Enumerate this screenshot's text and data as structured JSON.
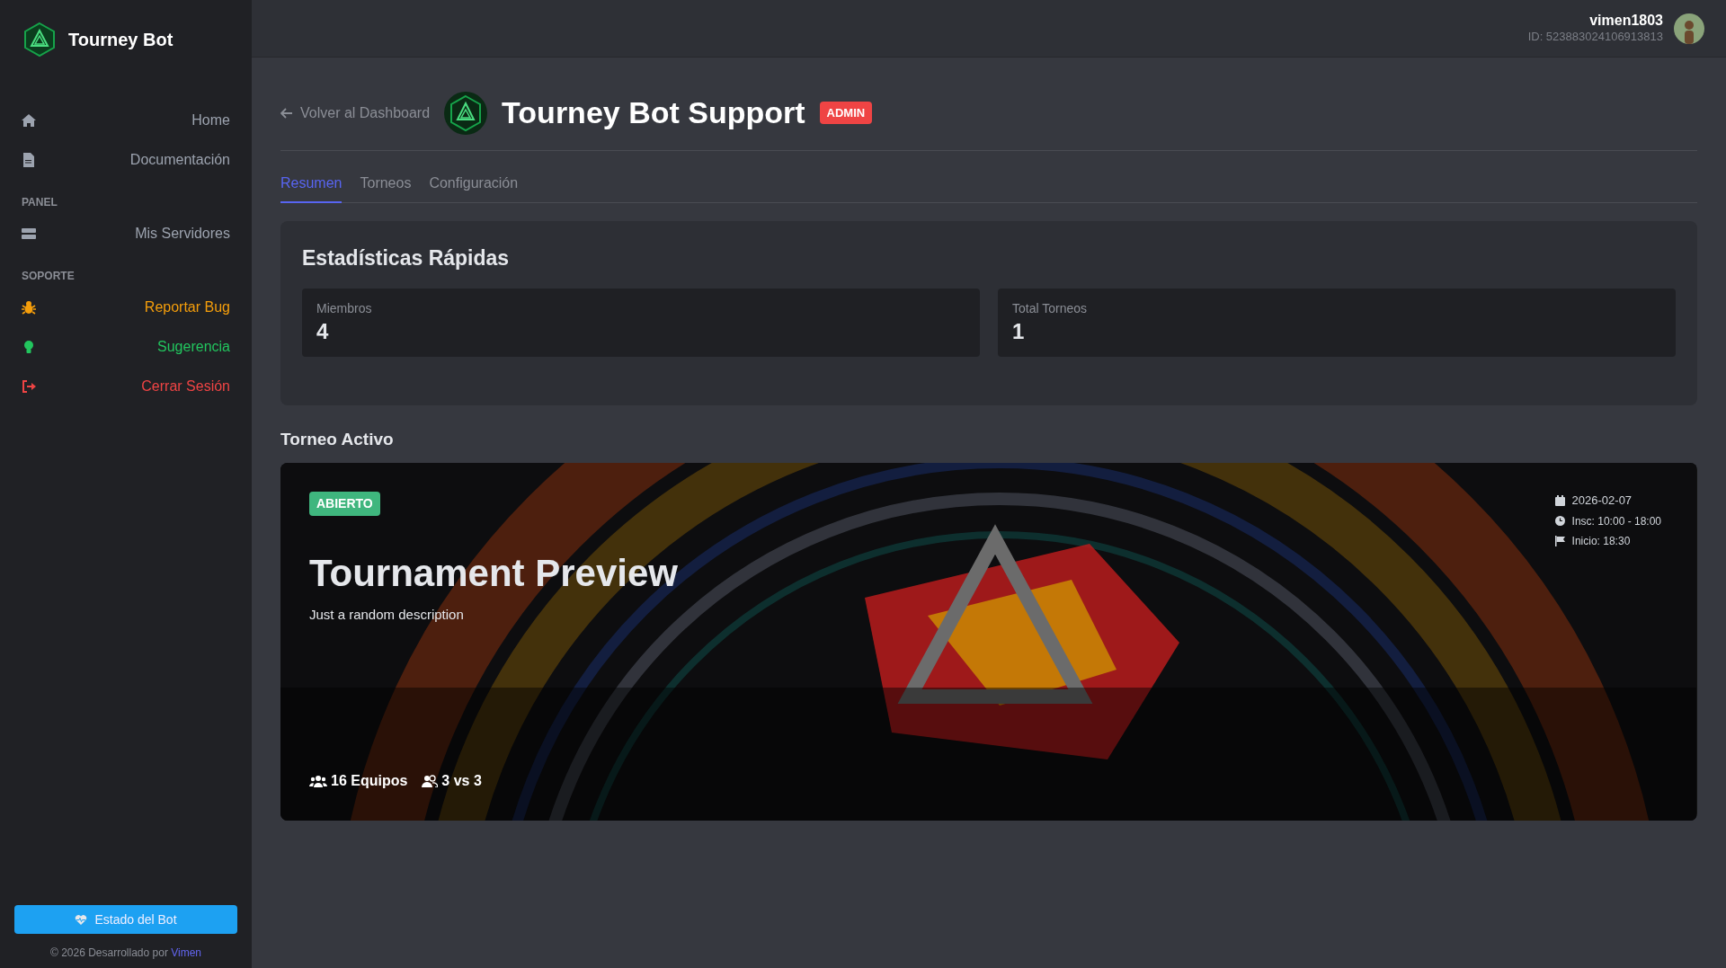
{
  "sidebar": {
    "brand": "Tourney Bot",
    "sections": [
      {
        "items": [
          {
            "label": "Home",
            "color": "#9ca3af"
          },
          {
            "label": "Documentación",
            "color": "#9ca3af"
          }
        ]
      },
      {
        "heading": "PANEL",
        "items": [
          {
            "label": "Mis Servidores",
            "color": "#9ca3af"
          }
        ]
      },
      {
        "heading": "SOPORTE",
        "items": [
          {
            "label": "Reportar Bug",
            "color": "#f59e0b"
          },
          {
            "label": "Sugerencia",
            "color": "#22c55e"
          },
          {
            "label": "Cerrar Sesión",
            "color": "#ef4444"
          }
        ]
      }
    ],
    "status_button": "Estado del Bot",
    "footer": "© 2026 Desarrollado por",
    "footer_link": "Vimen"
  },
  "user": {
    "name": "vimen1803",
    "id": "ID: 523883024106913813"
  },
  "back_link": "Volver al Dashboard",
  "server_name": "Tourney Bot Support",
  "role_badge": "ADMIN",
  "tabs": [
    {
      "label": "Resumen",
      "selected": true
    },
    {
      "label": "Torneos",
      "selected": false
    },
    {
      "label": "Configuración",
      "selected": false
    }
  ],
  "stats": {
    "title": "Estadísticas Rápidas",
    "cards": [
      {
        "label": "Miembros",
        "value": "4"
      },
      {
        "label": "Total Torneos",
        "value": "1"
      }
    ]
  },
  "active_tournament": {
    "heading": "Torneo Activo",
    "status": "ABIERTO",
    "title": "Tournament Preview",
    "description": "Just a random description",
    "date": "2026-02-07",
    "registration": "Insc: 10:00 - 18:00",
    "start": "Inicio: 18:30",
    "teams": "16 Equipos",
    "format": "3 vs 3"
  }
}
